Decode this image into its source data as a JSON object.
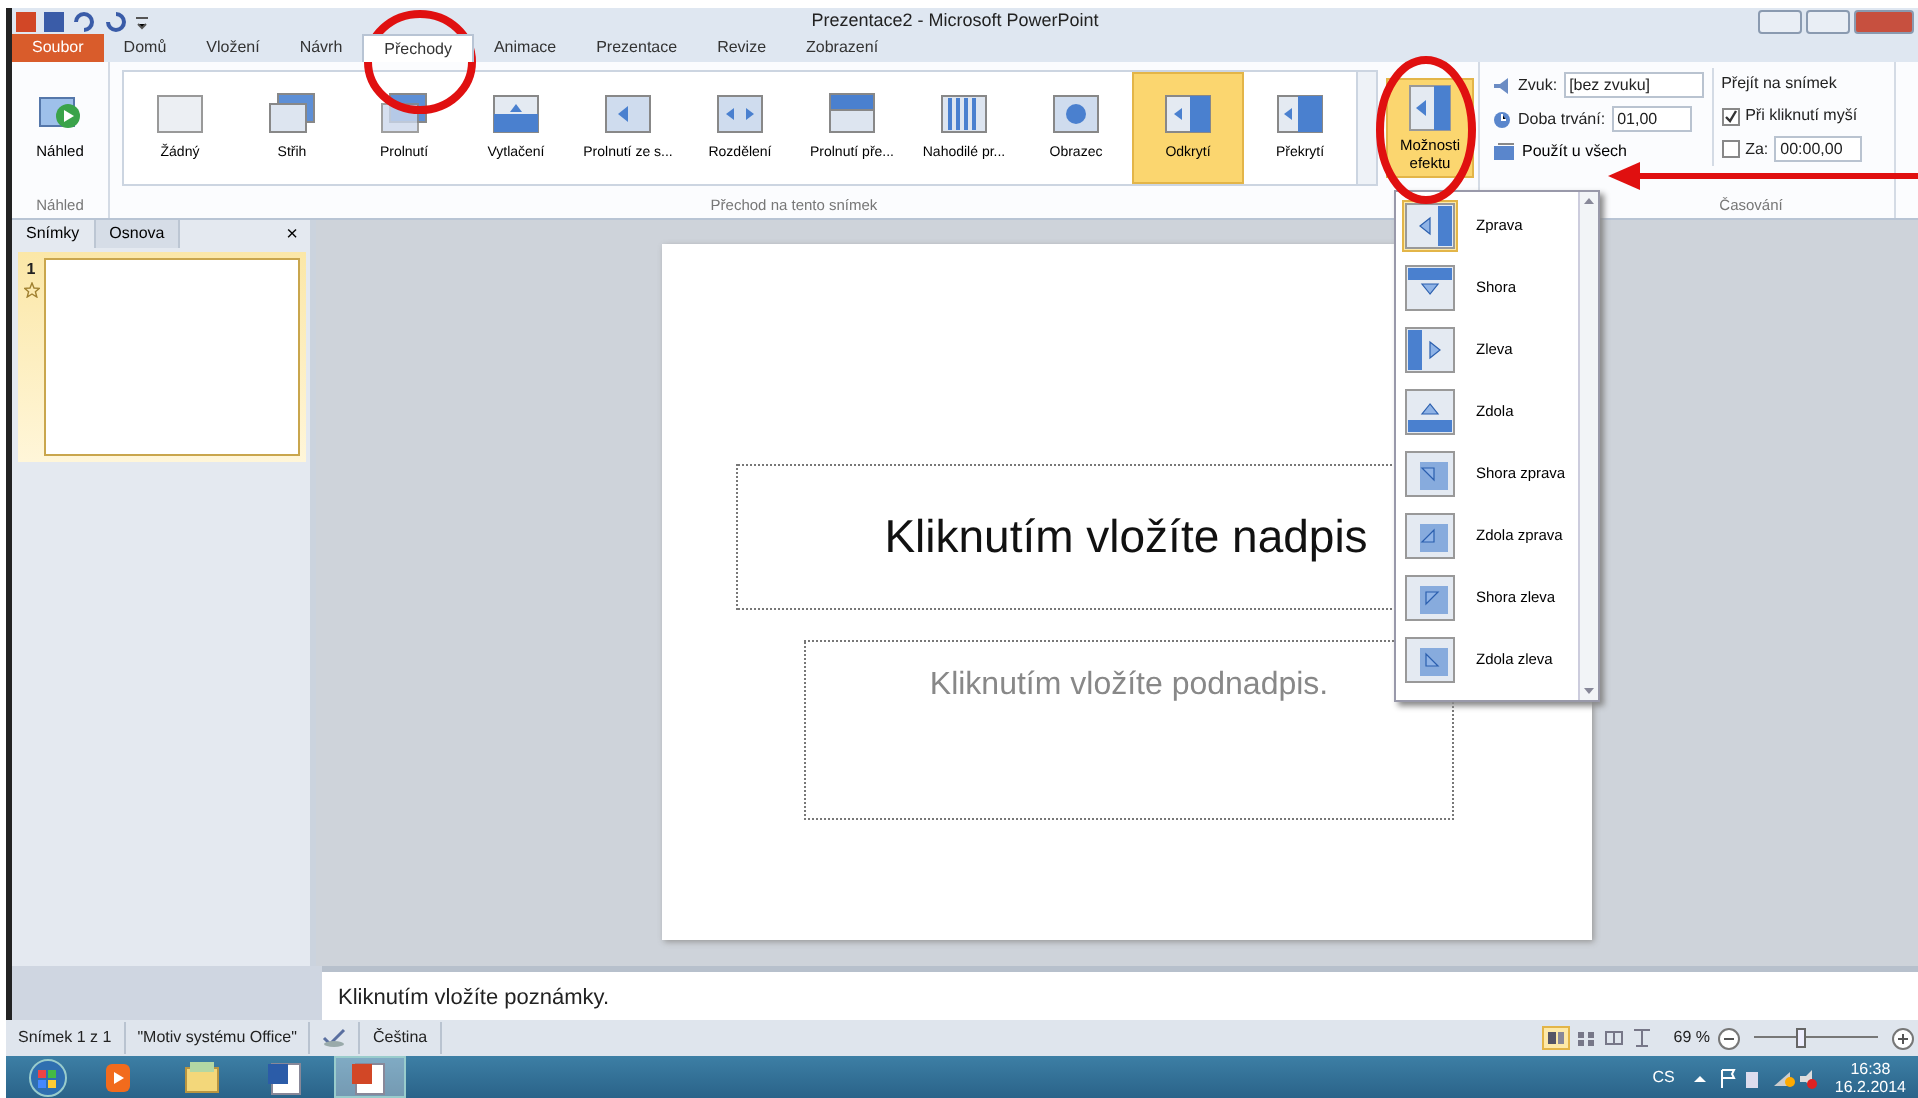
{
  "title_bar": {
    "title": "Prezentace2 - Microsoft PowerPoint"
  },
  "ribbon_tabs": [
    {
      "label": "Soubor",
      "kind": "file",
      "selected": false
    },
    {
      "label": "Domů",
      "kind": "tab",
      "selected": false
    },
    {
      "label": "Vložení",
      "kind": "tab",
      "selected": false
    },
    {
      "label": "Návrh",
      "kind": "tab",
      "selected": false
    },
    {
      "label": "Přechody",
      "kind": "tab",
      "selected": true
    },
    {
      "label": "Animace",
      "kind": "tab",
      "selected": false
    },
    {
      "label": "Prezentace",
      "kind": "tab",
      "selected": false
    },
    {
      "label": "Revize",
      "kind": "tab",
      "selected": false
    },
    {
      "label": "Zobrazení",
      "kind": "tab",
      "selected": false
    }
  ],
  "preview_group": {
    "button": "Náhled",
    "label": "Náhled"
  },
  "transitions_group": {
    "label": "Přechod na tento snímek",
    "items": [
      {
        "label": "Žádný",
        "selected": false
      },
      {
        "label": "Střih",
        "selected": false
      },
      {
        "label": "Prolnutí",
        "selected": false
      },
      {
        "label": "Vytlačení",
        "selected": false
      },
      {
        "label": "Prolnutí ze s...",
        "selected": false
      },
      {
        "label": "Rozdělení",
        "selected": false
      },
      {
        "label": "Prolnutí pře...",
        "selected": false
      },
      {
        "label": "Nahodilé pr...",
        "selected": false
      },
      {
        "label": "Obrazec",
        "selected": false
      },
      {
        "label": "Odkrytí",
        "selected": true
      },
      {
        "label": "Překrytí",
        "selected": false
      }
    ]
  },
  "effect_options": {
    "label": "Možnosti efektu",
    "expanded": true
  },
  "timing_group": {
    "label": "Časování",
    "sound_label": "Zvuk:",
    "sound_value": "[bez zvuku]",
    "duration_label": "Doba trvání:",
    "duration_value": "01,00",
    "apply_all": "Použít u všech",
    "advance_title": "Přejít na snímek",
    "on_click": {
      "label": "Při kliknutí myší",
      "checked": true
    },
    "after": {
      "label": "Za:",
      "checked": false,
      "value": "00:00,00"
    }
  },
  "effect_menu": [
    {
      "label": "Zprava",
      "selected": true
    },
    {
      "label": "Shora",
      "selected": false
    },
    {
      "label": "Zleva",
      "selected": false
    },
    {
      "label": "Zdola",
      "selected": false
    },
    {
      "label": "Shora zprava",
      "selected": false
    },
    {
      "label": "Zdola zprava",
      "selected": false
    },
    {
      "label": "Shora zleva",
      "selected": false
    },
    {
      "label": "Zdola zleva",
      "selected": false
    }
  ],
  "slides_pane": {
    "tabs": [
      {
        "label": "Snímky",
        "selected": true
      },
      {
        "label": "Osnova",
        "selected": false
      }
    ],
    "close": "×",
    "thumbnails": [
      {
        "number": "1",
        "selected": true
      }
    ]
  },
  "slide": {
    "title_placeholder": "Kliknutím vložíte nadpis",
    "subtitle_placeholder": "Kliknutím vložíte podnadpis."
  },
  "notes": {
    "placeholder": "Kliknutím vložíte poznámky."
  },
  "status_bar": {
    "slide": "Snímek 1 z 1",
    "theme": "\"Motiv systému Office\"",
    "language": "Čeština",
    "zoom": "69 %",
    "zoom_slider": {
      "level": 0.37
    }
  },
  "taskbar": {
    "apps": [
      {
        "kind": "media",
        "active": false
      },
      {
        "kind": "explorer",
        "active": false
      },
      {
        "kind": "word",
        "active": false
      },
      {
        "kind": "powerpoint",
        "active": true
      }
    ],
    "tray": {
      "language": "CS",
      "time": "16:38",
      "date": "16.2.2014"
    }
  }
}
